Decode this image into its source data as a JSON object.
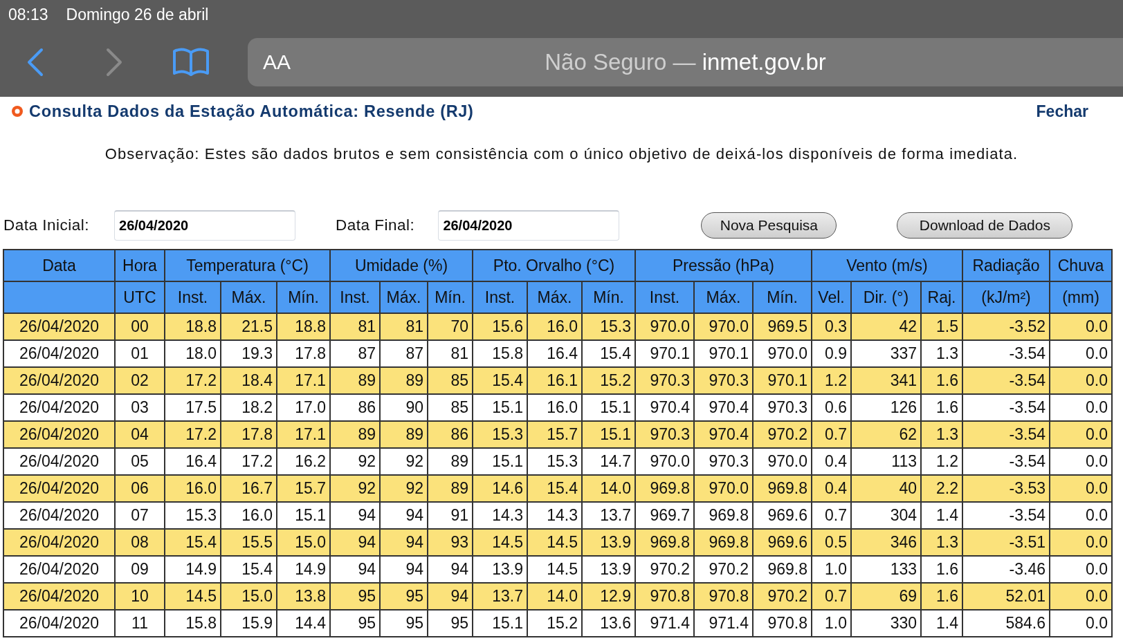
{
  "status_bar": {
    "time": "08:13",
    "date": "Domingo 26 de abril"
  },
  "browser": {
    "back_enabled": true,
    "forward_enabled": false,
    "text_size": "AA",
    "address_prefix": "Não Seguro —",
    "domain": "inmet.gov.br"
  },
  "page": {
    "title": "Consulta Dados da Estação Automática: Resende (RJ)",
    "close_link": "Fechar",
    "note": "Observação: Estes são dados brutos e sem consistência com o único objetivo de deixá-los disponíveis de forma imediata."
  },
  "form": {
    "fields": [
      {
        "label": "Data Inicial:",
        "value": "26/04/2020"
      },
      {
        "label": "Data Final:",
        "value": "26/04/2020"
      }
    ],
    "buttons": [
      "Nova Pesquisa",
      "Download de Dados"
    ]
  },
  "table": {
    "groups": [
      {
        "label": "Data"
      },
      {
        "label": "Hora",
        "columns": [
          "UTC"
        ]
      },
      {
        "label": "Temperatura (°C)",
        "columns": [
          "Inst.",
          "Máx.",
          "Mín."
        ]
      },
      {
        "label": "Umidade (%)",
        "columns": [
          "Inst.",
          "Máx.",
          "Mín."
        ]
      },
      {
        "label": "Pto. Orvalho (°C)",
        "columns": [
          "Inst.",
          "Máx.",
          "Mín."
        ]
      },
      {
        "label": "Pressão (hPa)",
        "columns": [
          "Inst.",
          "Máx.",
          "Mín."
        ]
      },
      {
        "label": "Vento (m/s)",
        "columns": [
          "Vel.",
          "Dir. (°)",
          "Raj."
        ]
      },
      {
        "label": "Radiação",
        "columns": [
          "(kJ/m²)"
        ]
      },
      {
        "label": "Chuva",
        "columns": [
          "(mm)"
        ]
      }
    ],
    "rows": [
      [
        "26/04/2020",
        "00",
        "18.8",
        "21.5",
        "18.8",
        "81",
        "81",
        "70",
        "15.6",
        "16.0",
        "15.3",
        "970.0",
        "970.0",
        "969.5",
        "0.3",
        "42",
        "1.5",
        "-3.52",
        "0.0"
      ],
      [
        "26/04/2020",
        "01",
        "18.0",
        "19.3",
        "17.8",
        "87",
        "87",
        "81",
        "15.8",
        "16.4",
        "15.4",
        "970.1",
        "970.1",
        "970.0",
        "0.9",
        "337",
        "1.3",
        "-3.54",
        "0.0"
      ],
      [
        "26/04/2020",
        "02",
        "17.2",
        "18.4",
        "17.1",
        "89",
        "89",
        "85",
        "15.4",
        "16.1",
        "15.2",
        "970.3",
        "970.3",
        "970.1",
        "1.2",
        "341",
        "1.6",
        "-3.54",
        "0.0"
      ],
      [
        "26/04/2020",
        "03",
        "17.5",
        "18.2",
        "17.0",
        "86",
        "90",
        "85",
        "15.1",
        "16.0",
        "15.1",
        "970.4",
        "970.4",
        "970.3",
        "0.6",
        "126",
        "1.6",
        "-3.54",
        "0.0"
      ],
      [
        "26/04/2020",
        "04",
        "17.2",
        "17.8",
        "17.1",
        "89",
        "89",
        "86",
        "15.3",
        "15.7",
        "15.1",
        "970.3",
        "970.4",
        "970.2",
        "0.7",
        "62",
        "1.3",
        "-3.54",
        "0.0"
      ],
      [
        "26/04/2020",
        "05",
        "16.4",
        "17.2",
        "16.2",
        "92",
        "92",
        "89",
        "15.1",
        "15.3",
        "14.7",
        "970.0",
        "970.3",
        "970.0",
        "0.4",
        "113",
        "1.2",
        "-3.54",
        "0.0"
      ],
      [
        "26/04/2020",
        "06",
        "16.0",
        "16.7",
        "15.7",
        "92",
        "92",
        "89",
        "14.6",
        "15.4",
        "14.0",
        "969.8",
        "970.0",
        "969.8",
        "0.4",
        "40",
        "2.2",
        "-3.53",
        "0.0"
      ],
      [
        "26/04/2020",
        "07",
        "15.3",
        "16.0",
        "15.1",
        "94",
        "94",
        "91",
        "14.3",
        "14.3",
        "13.7",
        "969.7",
        "969.8",
        "969.6",
        "0.7",
        "304",
        "1.4",
        "-3.54",
        "0.0"
      ],
      [
        "26/04/2020",
        "08",
        "15.4",
        "15.5",
        "15.0",
        "94",
        "94",
        "93",
        "14.5",
        "14.5",
        "13.9",
        "969.8",
        "969.8",
        "969.6",
        "0.5",
        "346",
        "1.3",
        "-3.51",
        "0.0"
      ],
      [
        "26/04/2020",
        "09",
        "14.9",
        "15.4",
        "14.9",
        "94",
        "94",
        "94",
        "13.9",
        "14.5",
        "13.9",
        "970.2",
        "970.2",
        "969.8",
        "1.0",
        "133",
        "1.6",
        "-3.46",
        "0.0"
      ],
      [
        "26/04/2020",
        "10",
        "14.5",
        "15.0",
        "13.8",
        "95",
        "95",
        "94",
        "13.7",
        "14.0",
        "12.9",
        "970.8",
        "970.8",
        "970.2",
        "0.7",
        "69",
        "1.6",
        "52.01",
        "0.0"
      ],
      [
        "26/04/2020",
        "11",
        "15.8",
        "15.9",
        "14.4",
        "95",
        "95",
        "95",
        "15.1",
        "15.2",
        "13.6",
        "971.4",
        "971.4",
        "970.8",
        "1.0",
        "330",
        "1.4",
        "584.6",
        "0.0"
      ]
    ]
  }
}
